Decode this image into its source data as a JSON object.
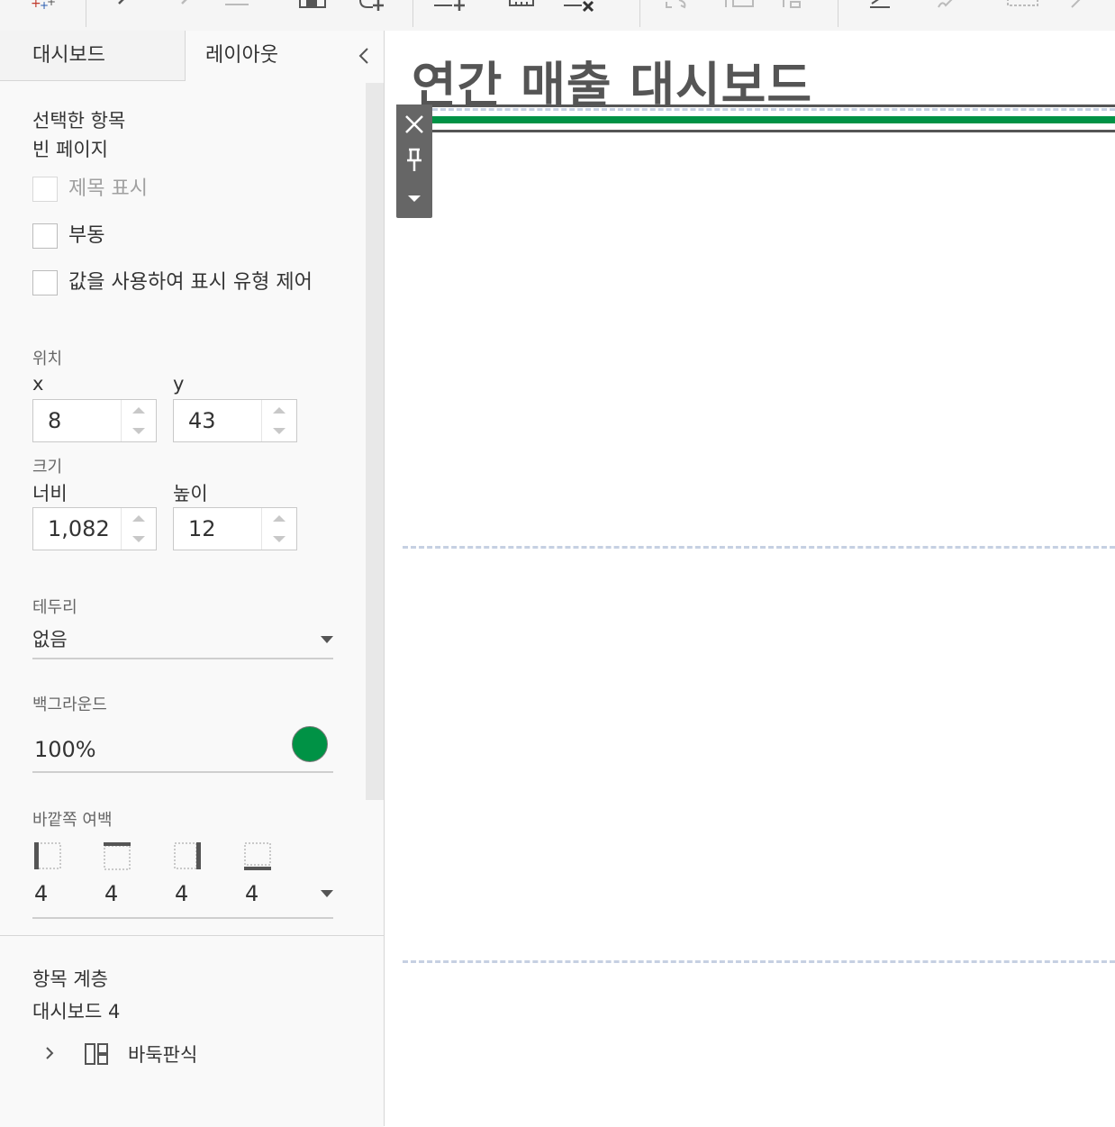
{
  "toolbar": {
    "icons": [
      "add-items-icon",
      "undo-icon",
      "redo-icon",
      "minus-icon",
      "save-icon",
      "new-worksheet-icon",
      "new-dashboard-icon",
      "clear-icon",
      "delete-icon",
      "swap-icon",
      "sort-asc-icon",
      "sort-desc-icon",
      "highlight-icon",
      "link-icon",
      "dashed-box-icon",
      "pin-icon"
    ]
  },
  "tabs": {
    "dashboard": "대시보드",
    "layout": "레이아웃"
  },
  "selected": {
    "header": "선택한 항목",
    "name": "빈 페이지"
  },
  "checkboxes": {
    "show_title": "제목 표시",
    "floating": "부동",
    "control_visibility": "값을 사용하여 표시 유형 제어"
  },
  "position": {
    "label": "위치",
    "x_label": "x",
    "y_label": "y",
    "x": "8",
    "y": "43"
  },
  "size": {
    "label": "크기",
    "width_label": "너비",
    "height_label": "높이",
    "width": "1,082",
    "height": "12"
  },
  "border": {
    "label": "테두리",
    "value": "없음"
  },
  "background": {
    "label": "백그라운드",
    "opacity": "100%",
    "color": "#009245"
  },
  "outer_padding": {
    "label": "바깥쪽 여백",
    "left": "4",
    "top": "4",
    "right": "4",
    "bottom": "4"
  },
  "hierarchy": {
    "label": "항목 계층",
    "root": "대시보드 4",
    "item": "바둑판식"
  },
  "canvas": {
    "title": "연간 매출 대시보드",
    "accent_color": "#009245"
  }
}
